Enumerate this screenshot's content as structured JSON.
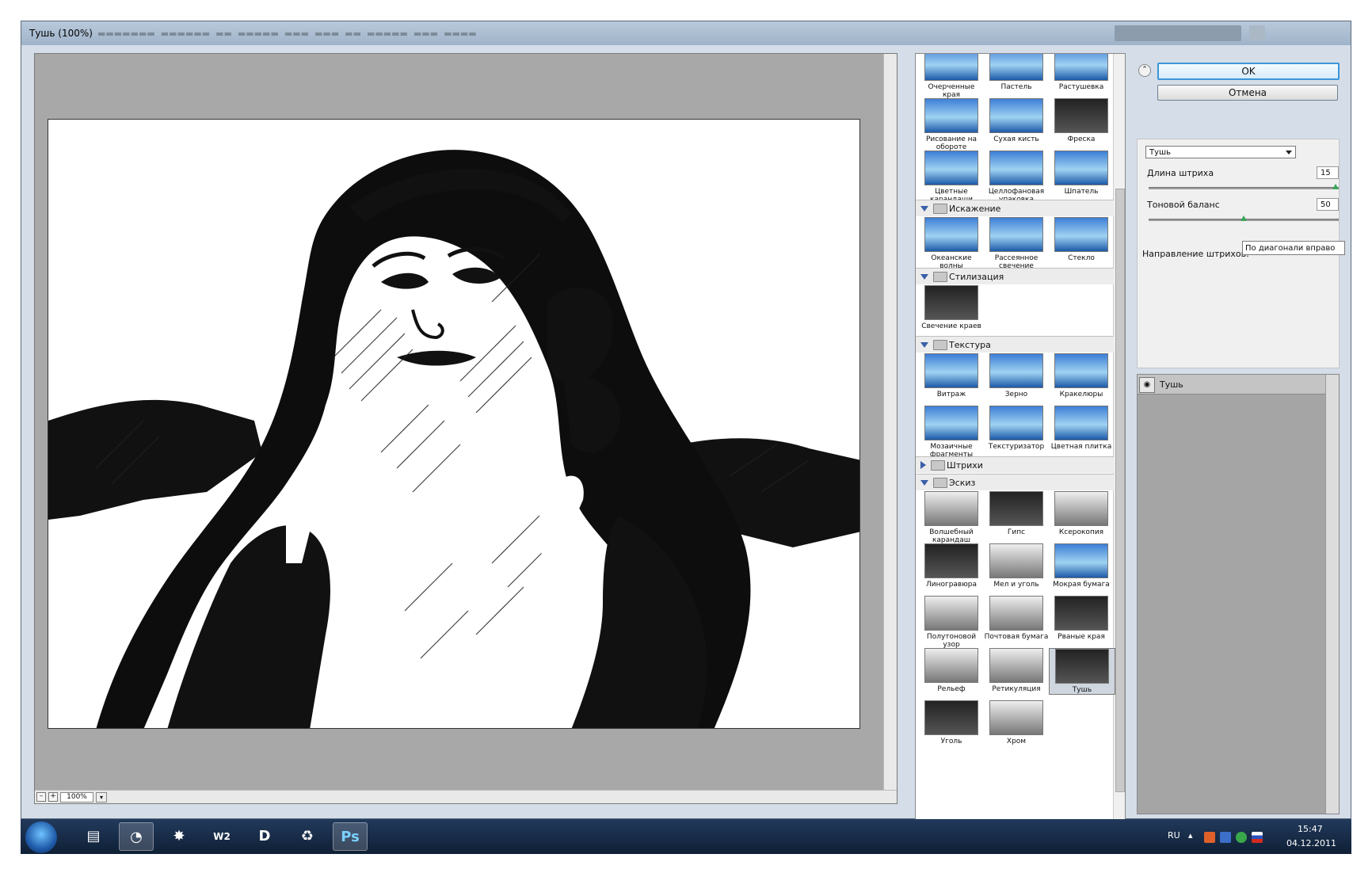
{
  "window": {
    "title": "Тушь (100%)"
  },
  "canvas": {
    "zoom": "100%",
    "zoom_minus": "–",
    "zoom_plus": "+"
  },
  "gallery": {
    "rows": [
      {
        "items": [
          "Очерченные края",
          "Пастель",
          "Растушевка"
        ]
      },
      {
        "items": [
          "Рисование на обороте",
          "Сухая кисть",
          "Фреска"
        ]
      },
      {
        "items": [
          "Цветные карандаши",
          "Целлофановая упаковка",
          "Шпатель"
        ]
      }
    ],
    "categories": [
      {
        "label": "Искажение",
        "expanded": true,
        "items": [
          "Океанские волны",
          "Рассеянное свечение",
          "Стекло"
        ]
      },
      {
        "label": "Стилизация",
        "expanded": true,
        "items": [
          "Свечение краев"
        ]
      },
      {
        "label": "Текстура",
        "expanded": true,
        "items": [
          "Витраж",
          "Зерно",
          "Кракелюры",
          "Мозаичные фрагменты",
          "Текстуризатор",
          "Цветная плитка"
        ]
      },
      {
        "label": "Штрихи",
        "expanded": false,
        "items": []
      },
      {
        "label": "Эскиз",
        "expanded": true,
        "items": [
          "Волшебный карандаш",
          "Гипс",
          "Ксерокопия",
          "Линогравюра",
          "Мел и уголь",
          "Мокрая бумага",
          "Полутоновой узор",
          "Почтовая бумага",
          "Рваные края",
          "Рельеф",
          "Ретикуляция",
          "Тушь",
          "Уголь",
          "Хром"
        ]
      }
    ],
    "selected": "Тушь"
  },
  "settings": {
    "ok_label": "OK",
    "cancel_label": "Отмена",
    "filter_select": "Тушь",
    "params": [
      {
        "label": "Длина штриха",
        "value": "15",
        "fraction": 1.0
      },
      {
        "label": "Тоновой баланс",
        "value": "50",
        "fraction": 0.5
      }
    ],
    "direction_label": "Направление штрихов:",
    "direction_value": "По диагонали вправо"
  },
  "layers": {
    "items": [
      {
        "name": "Тушь"
      }
    ]
  },
  "taskbar": {
    "apps": [
      "folder",
      "browser",
      "game",
      "wf2",
      "d-app",
      "recycle",
      "Ps"
    ],
    "language": "RU",
    "time": "15:47",
    "date": "04.12.2011"
  },
  "colors": {
    "accent": "#3d95d8",
    "taskbar": "#1a2f4d",
    "canvas_bg": "#a8a8a8",
    "category_arrow": "#3a5fa8"
  }
}
